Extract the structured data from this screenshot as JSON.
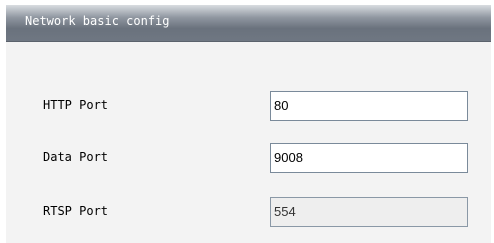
{
  "panel": {
    "title": "Network basic config"
  },
  "fields": [
    {
      "label": "HTTP Port",
      "value": "80",
      "editable": true
    },
    {
      "label": "Data Port",
      "value": "9008",
      "editable": true
    },
    {
      "label": "RTSP Port",
      "value": "554",
      "editable": false
    }
  ]
}
